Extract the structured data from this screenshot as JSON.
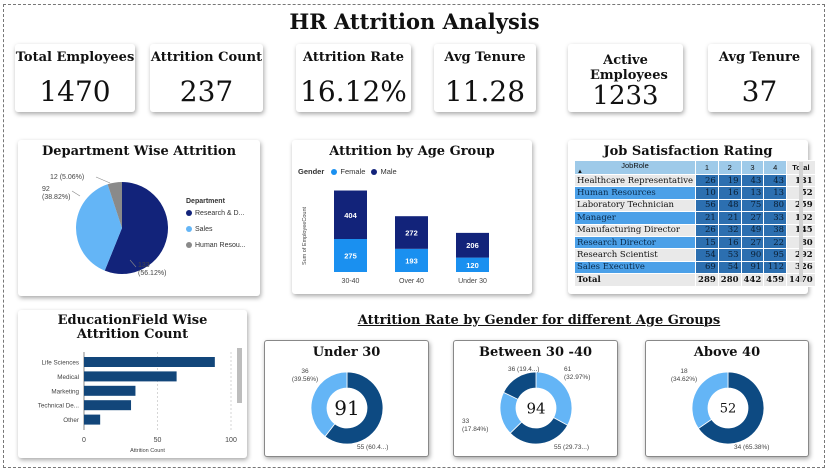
{
  "page": {
    "title": "HR Attrition Analysis"
  },
  "kpis": [
    {
      "label": "Total Employees",
      "value": "1470"
    },
    {
      "label": "Attrition Count",
      "value": "237"
    },
    {
      "label": "Attrition Rate",
      "value": "16.12%"
    },
    {
      "label": "Avg Tenure",
      "value": "11.28"
    },
    {
      "label": "Active Employees",
      "value": "1233"
    },
    {
      "label": "Avg Tenure",
      "value": "37"
    }
  ],
  "colors": {
    "navy": "#12237a",
    "blue": "#1a90f0",
    "light_blue": "#6cb4f7",
    "gray": "#8a8a8a",
    "dark_donut": "#0d4a82",
    "donut_light": "#64b5f6"
  },
  "chart_data": [
    {
      "type": "pie",
      "title": "Department Wise Attrition",
      "legend_title": "Department",
      "legend_position": "right",
      "labels": [
        "Research & D...",
        "Sales",
        "Human Resou..."
      ],
      "values": [
        133,
        92,
        12
      ],
      "colors": [
        "#12237a",
        "#64b5f6",
        "#8a8a8a"
      ],
      "data_labels": [
        "133\n(56.12%)",
        "92\n(38.82%)",
        "12 (5.06%)"
      ]
    },
    {
      "type": "bar",
      "stacked": true,
      "title": "Attrition by Age Group",
      "legend_title": "Gender",
      "legend_position": "top-left",
      "ylabel": "Sum of EmployeeCount",
      "categories": [
        "30-40",
        "Over 40",
        "Under 30"
      ],
      "series": [
        {
          "name": "Female",
          "values": [
            275,
            193,
            120
          ],
          "color": "#1a90f0"
        },
        {
          "name": "Male",
          "values": [
            404,
            272,
            206
          ],
          "color": "#12237a"
        }
      ]
    },
    {
      "type": "table",
      "title": "Job Satisfaction Rating",
      "columns": [
        "JobRole",
        "1",
        "2",
        "3",
        "4",
        "Total"
      ],
      "rows": [
        [
          "Healthcare Representative",
          "26",
          "19",
          "43",
          "43",
          "131"
        ],
        [
          "Human Resources",
          "10",
          "16",
          "13",
          "13",
          "52"
        ],
        [
          "Laboratory Technician",
          "56",
          "48",
          "75",
          "80",
          "259"
        ],
        [
          "Manager",
          "21",
          "21",
          "27",
          "33",
          "102"
        ],
        [
          "Manufacturing Director",
          "26",
          "32",
          "49",
          "38",
          "145"
        ],
        [
          "Research Director",
          "15",
          "16",
          "27",
          "22",
          "80"
        ],
        [
          "Research Scientist",
          "54",
          "53",
          "90",
          "95",
          "292"
        ],
        [
          "Sales Executive",
          "69",
          "54",
          "91",
          "112",
          "326"
        ]
      ],
      "highlighted_rows": [
        1,
        3,
        5,
        7
      ],
      "total_row": [
        "Total",
        "289",
        "280",
        "442",
        "459",
        "1470"
      ]
    },
    {
      "type": "bar",
      "orientation": "horizontal",
      "title": "EducationField Wise Attrition Count",
      "categories": [
        "Life Sciences",
        "Medical",
        "Marketing",
        "Technical De...",
        "Other"
      ],
      "values": [
        89,
        63,
        35,
        32,
        11
      ],
      "xlabel": "Attrition Count",
      "xlim": [
        0,
        100
      ],
      "xticks": [
        "0",
        "50",
        "100"
      ],
      "color": "#12467a"
    },
    {
      "type": "pie",
      "donut": true,
      "title": "Under 30",
      "center_value": "91",
      "values": [
        55,
        36
      ],
      "colors": [
        "#0d4a82",
        "#64b5f6"
      ],
      "data_labels": [
        "55 (60.4...)",
        "36\n(39.56%)"
      ]
    },
    {
      "type": "pie",
      "donut": true,
      "title": "Between 30 -40",
      "center_value": "94",
      "values": [
        61,
        55,
        36,
        33
      ],
      "colors": [
        "#64b5f6",
        "#0d4a82",
        "#64b5f6",
        "#0d4a82"
      ],
      "data_labels": [
        "61\n(32.97%)",
        "55 (29.73...)",
        "36 (19.4...)",
        "33\n(17.84%)"
      ]
    },
    {
      "type": "pie",
      "donut": true,
      "title": "Above 40",
      "center_value": "52",
      "values": [
        34,
        18
      ],
      "colors": [
        "#0d4a82",
        "#64b5f6"
      ],
      "data_labels": [
        "34 (65.38%)",
        "18\n(34.62%)"
      ]
    }
  ],
  "section": {
    "donut_group_title": "Attrition Rate by Gender for different Age Groups"
  }
}
